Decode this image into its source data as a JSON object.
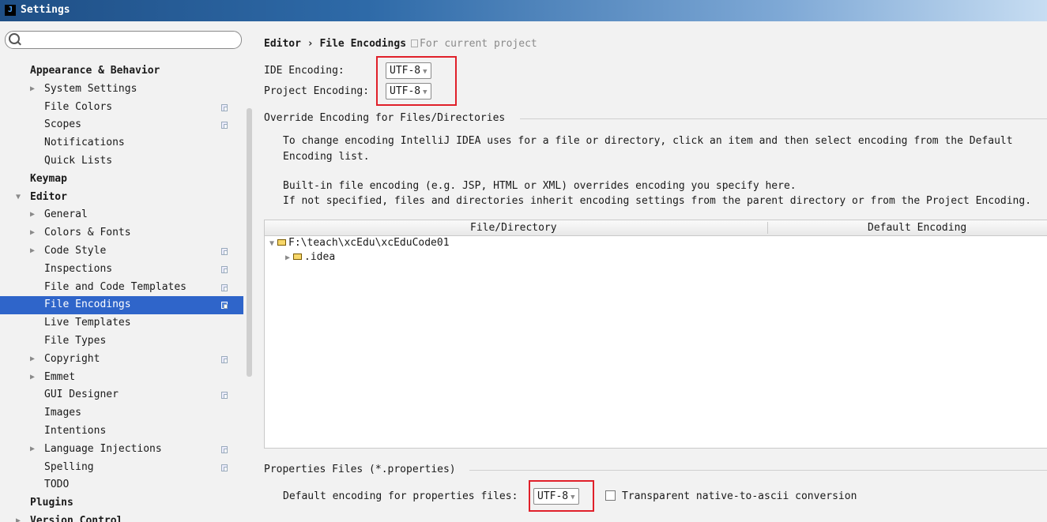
{
  "window": {
    "title": "Settings",
    "app_icon_letter": "J"
  },
  "search": {
    "placeholder": ""
  },
  "sidebar": {
    "items": [
      {
        "label": "Appearance & Behavior",
        "bold": true,
        "indent": 0,
        "arrow": "",
        "project": false
      },
      {
        "label": "System Settings",
        "bold": false,
        "indent": 1,
        "arrow": "▶",
        "project": false
      },
      {
        "label": "File Colors",
        "bold": false,
        "indent": 1,
        "arrow": "",
        "project": true
      },
      {
        "label": "Scopes",
        "bold": false,
        "indent": 1,
        "arrow": "",
        "project": true
      },
      {
        "label": "Notifications",
        "bold": false,
        "indent": 1,
        "arrow": "",
        "project": false
      },
      {
        "label": "Quick Lists",
        "bold": false,
        "indent": 1,
        "arrow": "",
        "project": false
      },
      {
        "label": "Keymap",
        "bold": true,
        "indent": 0,
        "arrow": "",
        "project": false
      },
      {
        "label": "Editor",
        "bold": true,
        "indent": 0,
        "arrow": "▼",
        "project": false
      },
      {
        "label": "General",
        "bold": false,
        "indent": 1,
        "arrow": "▶",
        "project": false
      },
      {
        "label": "Colors & Fonts",
        "bold": false,
        "indent": 1,
        "arrow": "▶",
        "project": false
      },
      {
        "label": "Code Style",
        "bold": false,
        "indent": 1,
        "arrow": "▶",
        "project": true
      },
      {
        "label": "Inspections",
        "bold": false,
        "indent": 1,
        "arrow": "",
        "project": true
      },
      {
        "label": "File and Code Templates",
        "bold": false,
        "indent": 1,
        "arrow": "",
        "project": true
      },
      {
        "label": "File Encodings",
        "bold": false,
        "indent": 1,
        "arrow": "",
        "project": true,
        "selected": true
      },
      {
        "label": "Live Templates",
        "bold": false,
        "indent": 1,
        "arrow": "",
        "project": false
      },
      {
        "label": "File Types",
        "bold": false,
        "indent": 1,
        "arrow": "",
        "project": false
      },
      {
        "label": "Copyright",
        "bold": false,
        "indent": 1,
        "arrow": "▶",
        "project": true
      },
      {
        "label": "Emmet",
        "bold": false,
        "indent": 1,
        "arrow": "▶",
        "project": false
      },
      {
        "label": "GUI Designer",
        "bold": false,
        "indent": 1,
        "arrow": "",
        "project": true
      },
      {
        "label": "Images",
        "bold": false,
        "indent": 1,
        "arrow": "",
        "project": false
      },
      {
        "label": "Intentions",
        "bold": false,
        "indent": 1,
        "arrow": "",
        "project": false
      },
      {
        "label": "Language Injections",
        "bold": false,
        "indent": 1,
        "arrow": "▶",
        "project": true
      },
      {
        "label": "Spelling",
        "bold": false,
        "indent": 1,
        "arrow": "",
        "project": true
      },
      {
        "label": "TODO",
        "bold": false,
        "indent": 1,
        "arrow": "",
        "project": false
      },
      {
        "label": "Plugins",
        "bold": true,
        "indent": 0,
        "arrow": "",
        "project": false
      },
      {
        "label": "Version Control",
        "bold": true,
        "indent": 0,
        "arrow": "▶",
        "project": false
      }
    ]
  },
  "breadcrumb": {
    "parent": "Editor",
    "separator": "›",
    "current": "File Encodings",
    "note": "For current project"
  },
  "ide_encoding": {
    "label": "IDE Encoding:",
    "value": "UTF-8"
  },
  "project_encoding": {
    "label": "Project Encoding:",
    "value": "UTF-8"
  },
  "override": {
    "title": "Override Encoding for Files/Directories",
    "para1_line1": "To change encoding IntelliJ IDEA uses for a file or directory, click an item and then select encoding from the Default",
    "para1_line2": "Encoding list.",
    "para2_line1": "Built-in file encoding (e.g. JSP, HTML or XML) overrides encoding you specify here.",
    "para2_line2": "If not specified, files and directories inherit encoding settings from the parent directory or from the Project Encoding."
  },
  "table": {
    "columns": [
      "File/Directory",
      "Default Encoding"
    ],
    "rows": [
      {
        "arrow": "▼",
        "path": "F:\\teach\\xcEdu\\xcEduCode01"
      },
      {
        "arrow": "▶",
        "path": ".idea"
      }
    ]
  },
  "properties": {
    "title": "Properties Files (*.properties)",
    "label": "Default encoding for properties files:",
    "value": "UTF-8",
    "checkbox_label": "Transparent native-to-ascii conversion",
    "checkbox_checked": false
  },
  "colors": {
    "selection": "#2f65ca",
    "highlight_box": "#e0202a"
  }
}
